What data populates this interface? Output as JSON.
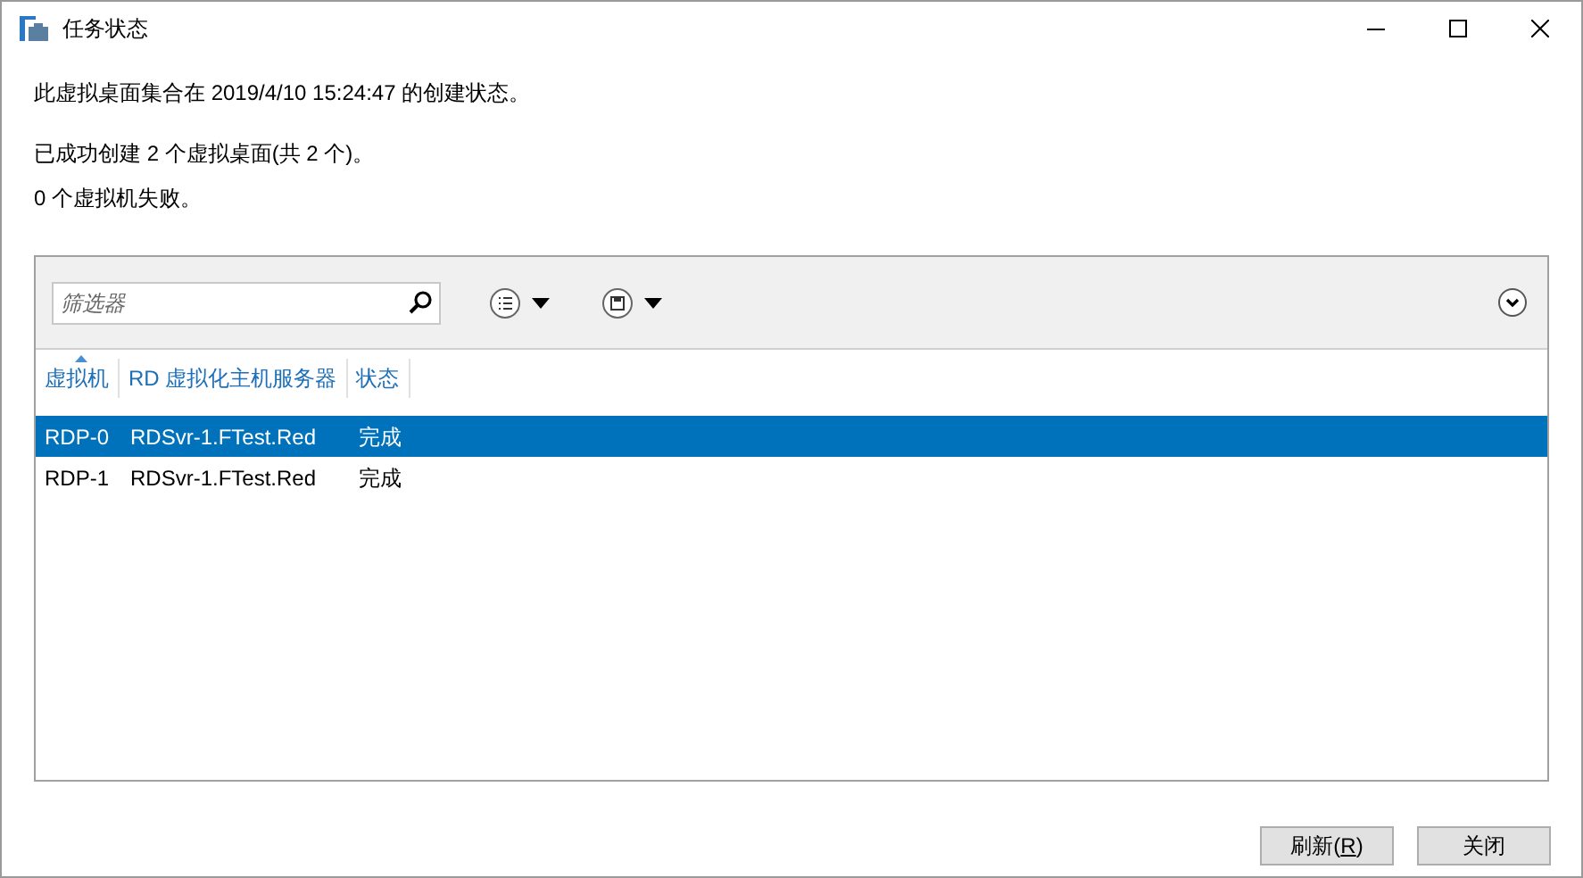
{
  "window": {
    "title": "任务状态"
  },
  "messages": [
    "此虚拟桌面集合在 2019/4/10 15:24:47 的创建状态。",
    "已成功创建 2 个虚拟桌面(共 2 个)。",
    "0 个虚拟机失败。"
  ],
  "filter": {
    "placeholder": "筛选器"
  },
  "columns": [
    {
      "label": "虚拟机",
      "sorted": true
    },
    {
      "label": "RD 虚拟化主机服务器",
      "sorted": false
    },
    {
      "label": "状态",
      "sorted": false
    }
  ],
  "rows": [
    {
      "cells": [
        "RDP-0",
        "RDSvr-1.FTest.Red",
        "完成"
      ],
      "selected": true
    },
    {
      "cells": [
        "RDP-1",
        "RDSvr-1.FTest.Red",
        "完成"
      ],
      "selected": false
    }
  ],
  "buttons": [
    {
      "before": "刷新(",
      "access_key": "R",
      "after": ")"
    },
    {
      "before": "关闭"
    }
  ]
}
